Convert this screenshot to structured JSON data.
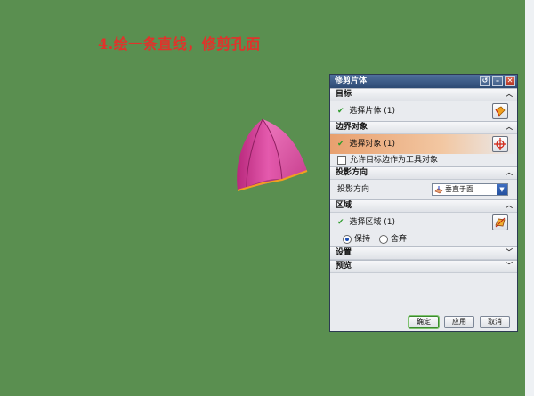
{
  "instruction": "4.绘一条直线，修剪孔面",
  "dialog": {
    "title": "修剪片体",
    "sections": {
      "target": {
        "header": "目标",
        "select_label": "选择片体 (1)"
      },
      "boundary": {
        "header": "边界对象",
        "select_label": "选择对象 (1)",
        "checkbox_label": "允许目标边作为工具对象"
      },
      "projection": {
        "header": "投影方向",
        "label": "投影方向",
        "value": "垂直于面"
      },
      "region": {
        "header": "区域",
        "select_label": "选择区域 (1)",
        "keep": "保持",
        "discard": "舍弃"
      },
      "settings": {
        "header": "设置"
      },
      "preview": {
        "header": "预览"
      }
    },
    "buttons": {
      "ok": "确定",
      "apply": "应用",
      "cancel": "取消"
    }
  },
  "colors": {
    "background": "#5a8f50",
    "instruction": "#e0332b",
    "model_fill": "#d94aa0",
    "edge": "#f0a020"
  }
}
